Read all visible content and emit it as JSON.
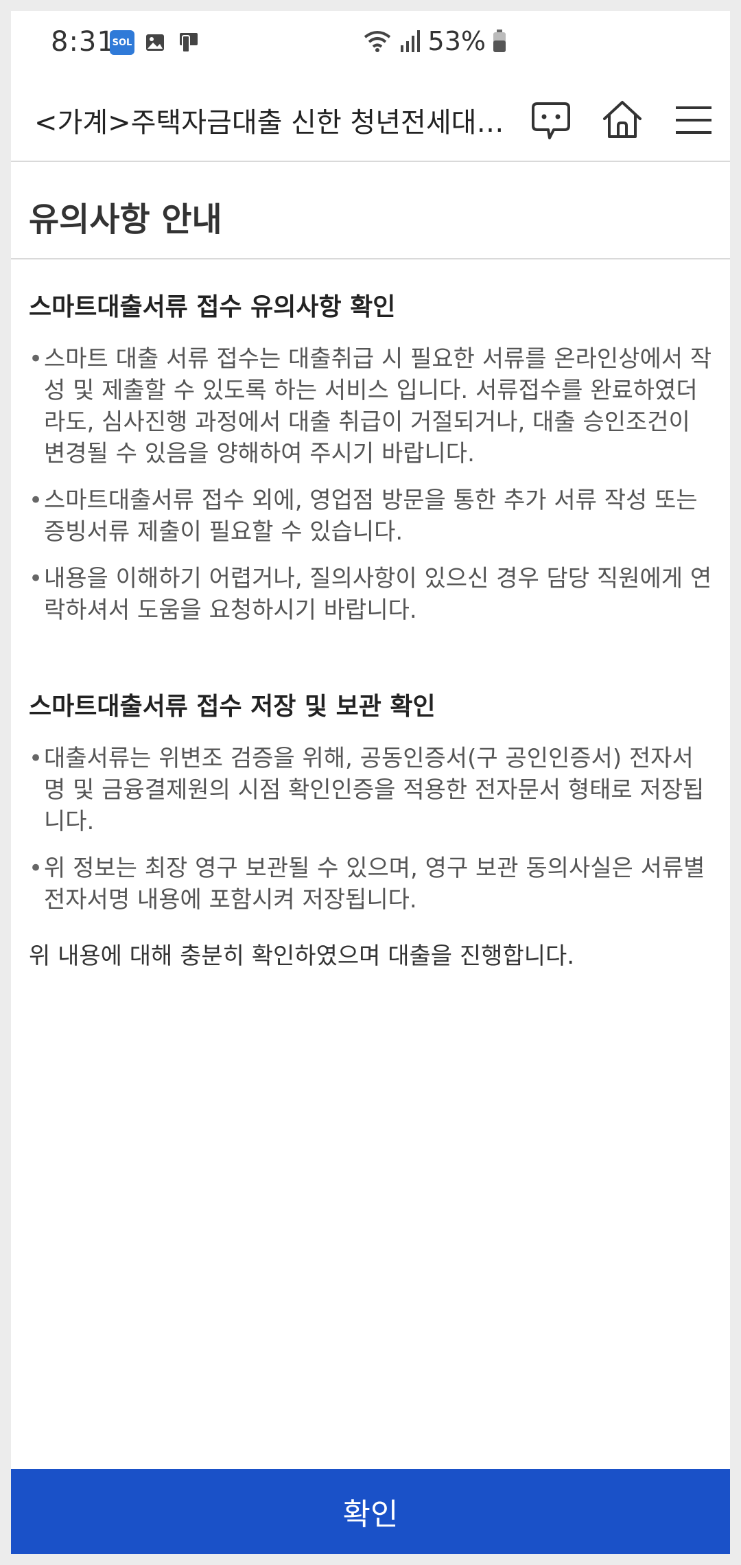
{
  "status_bar": {
    "time": "8:31",
    "app_badge": "SOL",
    "battery": "53%",
    "icons": [
      "sol-app-icon",
      "gallery-icon",
      "device-icon",
      "wifi-icon",
      "signal-icon",
      "battery-icon"
    ]
  },
  "header": {
    "title": "<가계>주택자금대출 신한 청년전세대…",
    "icons": [
      "chat-icon",
      "home-icon",
      "menu-icon"
    ]
  },
  "page": {
    "title": "유의사항 안내"
  },
  "sections": [
    {
      "title": "스마트대출서류 접수 유의사항 확인",
      "items": [
        "스마트 대출 서류 접수는 대출취급 시 필요한 서류를 온라인상에서 작성 및 제출할 수 있도록 하는 서비스 입니다. 서류접수를 완료하였더라도, 심사진행 과정에서 대출 취급이 거절되거나, 대출 승인조건이 변경될 수 있음을 양해하여 주시기 바랍니다.",
        "스마트대출서류 접수 외에, 영업점 방문을 통한 추가 서류 작성 또는 증빙서류 제출이 필요할 수 있습니다.",
        "내용을 이해하기 어렵거나, 질의사항이 있으신 경우 담당 직원에게 연락하셔서 도움을 요청하시기 바랍니다."
      ]
    },
    {
      "title": "스마트대출서류 접수 저장 및 보관 확인",
      "items": [
        "대출서류는 위변조 검증을 위해, 공동인증서(구 공인인증서) 전자서명 및 금융결제원의 시점 확인인증을 적용한 전자문서 형태로 저장됩니다.",
        "위 정보는 최장 영구 보관될 수 있으며, 영구 보관 동의사실은 서류별 전자서명 내용에 포함시켜 저장됩니다."
      ]
    }
  ],
  "confirm_text": "위 내용에 대해 충분히 확인하였으며 대출을 진행합니다.",
  "confirm_button": {
    "label": "확인",
    "color": "#1a51c8"
  }
}
